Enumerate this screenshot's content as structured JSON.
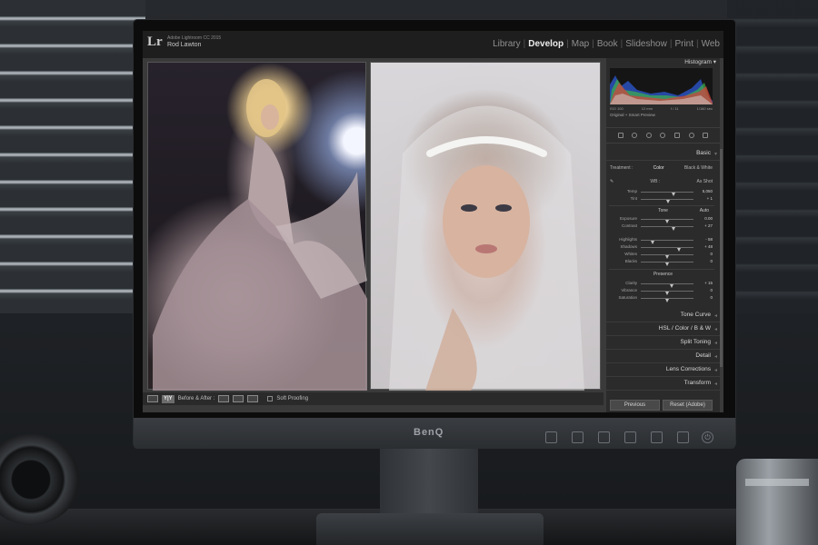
{
  "app": {
    "logo": "Lr",
    "version": "Adobe Lightroom CC 2015",
    "user": "Rod Lawton"
  },
  "modules": [
    {
      "label": "Library",
      "active": false
    },
    {
      "label": "Develop",
      "active": true
    },
    {
      "label": "Map",
      "active": false
    },
    {
      "label": "Book",
      "active": false
    },
    {
      "label": "Slideshow",
      "active": false
    },
    {
      "label": "Print",
      "active": false
    },
    {
      "label": "Web",
      "active": false
    }
  ],
  "histogram": {
    "title": "Histogram",
    "iso": "ISO 100",
    "focal": "12 mm",
    "aperture": "f / 11",
    "shutter": "1/160 sec",
    "smart_preview": "Original + Smart Preview"
  },
  "basic": {
    "title": "Basic",
    "treatment_label": "Treatment :",
    "color": "Color",
    "bw": "Black & White",
    "wb_label": "WB :",
    "wb_value": "As Shot",
    "tone_title": "Tone",
    "auto": "Auto",
    "presence_title": "Presence",
    "sliders": {
      "temp": {
        "label": "Temp",
        "value": "5,050",
        "pos": 0.62
      },
      "tint": {
        "label": "Tint",
        "value": "+ 1",
        "pos": 0.52
      },
      "exposure": {
        "label": "Exposure",
        "value": "0.00",
        "pos": 0.5
      },
      "contrast": {
        "label": "Contrast",
        "value": "+ 27",
        "pos": 0.62
      },
      "highlights": {
        "label": "Highlights",
        "value": "- 58",
        "pos": 0.22
      },
      "shadows": {
        "label": "Shadows",
        "value": "+ 48",
        "pos": 0.73
      },
      "whites": {
        "label": "Whites",
        "value": "0",
        "pos": 0.5
      },
      "blacks": {
        "label": "Blacks",
        "value": "0",
        "pos": 0.5
      },
      "clarity": {
        "label": "Clarity",
        "value": "+ 15",
        "pos": 0.58
      },
      "vibrance": {
        "label": "Vibrance",
        "value": "0",
        "pos": 0.5
      },
      "saturation": {
        "label": "Saturation",
        "value": "0",
        "pos": 0.5
      }
    }
  },
  "sections": {
    "tone_curve": "Tone Curve",
    "hsl": "HSL  /  Color  /  B & W",
    "split_toning": "Split Toning",
    "detail": "Detail",
    "lens_corrections": "Lens Corrections",
    "transform": "Transform"
  },
  "buttons": {
    "previous": "Previous",
    "reset": "Reset (Adobe)"
  },
  "toolbar": {
    "view_mode": "Y|Y",
    "before_after": "Before & After :",
    "soft_proofing": "Soft Proofing"
  },
  "monitor": {
    "brand": "BenQ"
  },
  "colors": {
    "accent": "#ececec",
    "panel_bg": "#2b2b2b"
  }
}
